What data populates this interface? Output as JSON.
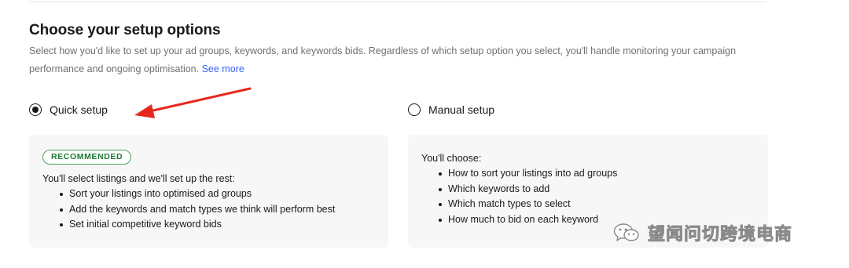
{
  "section": {
    "title": "Choose your setup options",
    "description": "Select how you'd like to set up your ad groups, keywords, and keywords bids. Regardless of which setup option you select, you'll handle monitoring your campaign performance and ongoing optimisation.",
    "see_more_label": "See more"
  },
  "options": {
    "quick": {
      "label": "Quick setup",
      "selected": true,
      "badge": "RECOMMENDED",
      "intro": "You'll select listings and we'll set up the rest:",
      "items": [
        "Sort your listings into optimised ad groups",
        "Add the keywords and match types we think will perform best",
        "Set initial competitive keyword bids"
      ]
    },
    "manual": {
      "label": "Manual setup",
      "selected": false,
      "intro": "You'll choose:",
      "items": [
        "How to sort your listings into ad groups",
        "Which keywords to add",
        "Which match types to select",
        "How much to bid on each keyword"
      ]
    }
  },
  "annotation": {
    "arrow_color": "#e8281e"
  },
  "watermark": {
    "text": "望闻问切跨境电商",
    "icon": "wechat-icon"
  },
  "colors": {
    "link": "#3665f3",
    "badge_border": "#48a05a",
    "card_bg": "#f7f7f7"
  }
}
